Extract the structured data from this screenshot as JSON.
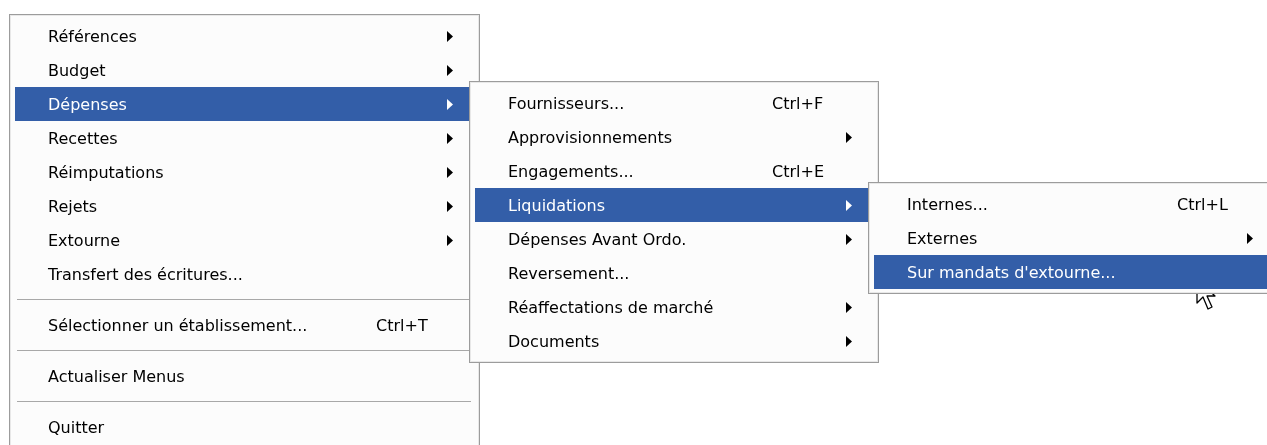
{
  "menu": {
    "items": [
      {
        "kind": "item",
        "label": "Références",
        "submenu_arrow": true,
        "selected": false
      },
      {
        "kind": "item",
        "label": "Budget",
        "submenu_arrow": true,
        "selected": false
      },
      {
        "kind": "item",
        "label": "Dépenses",
        "submenu_arrow": true,
        "selected": true,
        "submenu": {
          "items": [
            {
              "kind": "item",
              "label": "Fournisseurs...",
              "shortcut": "Ctrl+F",
              "submenu_arrow": false,
              "selected": false
            },
            {
              "kind": "item",
              "label": "Approvisionnements",
              "submenu_arrow": true,
              "selected": false
            },
            {
              "kind": "item",
              "label": "Engagements...",
              "shortcut": "Ctrl+E",
              "submenu_arrow": false,
              "selected": false
            },
            {
              "kind": "item",
              "label": "Liquidations",
              "submenu_arrow": true,
              "selected": true,
              "submenu": {
                "items": [
                  {
                    "kind": "item",
                    "label": "Internes...",
                    "shortcut": "Ctrl+L",
                    "submenu_arrow": false,
                    "selected": false
                  },
                  {
                    "kind": "item",
                    "label": "Externes",
                    "submenu_arrow": true,
                    "selected": false
                  },
                  {
                    "kind": "item",
                    "label": "Sur mandats d'extourne...",
                    "submenu_arrow": false,
                    "selected": true
                  }
                ]
              }
            },
            {
              "kind": "item",
              "label": "Dépenses Avant Ordo.",
              "submenu_arrow": true,
              "selected": false
            },
            {
              "kind": "item",
              "label": "Reversement...",
              "submenu_arrow": false,
              "selected": false
            },
            {
              "kind": "item",
              "label": "Réaffectations de marché",
              "submenu_arrow": true,
              "selected": false
            },
            {
              "kind": "item",
              "label": "Documents",
              "submenu_arrow": true,
              "selected": false
            }
          ]
        }
      },
      {
        "kind": "item",
        "label": "Recettes",
        "submenu_arrow": true,
        "selected": false
      },
      {
        "kind": "item",
        "label": "Réimputations",
        "submenu_arrow": true,
        "selected": false
      },
      {
        "kind": "item",
        "label": "Rejets",
        "submenu_arrow": true,
        "selected": false
      },
      {
        "kind": "item",
        "label": "Extourne",
        "submenu_arrow": true,
        "selected": false
      },
      {
        "kind": "item",
        "label": "Transfert des écritures...",
        "submenu_arrow": false,
        "selected": false
      },
      {
        "kind": "separator"
      },
      {
        "kind": "item",
        "label": "Sélectionner un établissement...",
        "shortcut": "Ctrl+T",
        "submenu_arrow": false,
        "selected": false
      },
      {
        "kind": "separator"
      },
      {
        "kind": "item",
        "label": "Actualiser Menus",
        "submenu_arrow": false,
        "selected": false
      },
      {
        "kind": "separator"
      },
      {
        "kind": "item",
        "label": "Quitter",
        "submenu_arrow": false,
        "selected": false
      }
    ]
  }
}
